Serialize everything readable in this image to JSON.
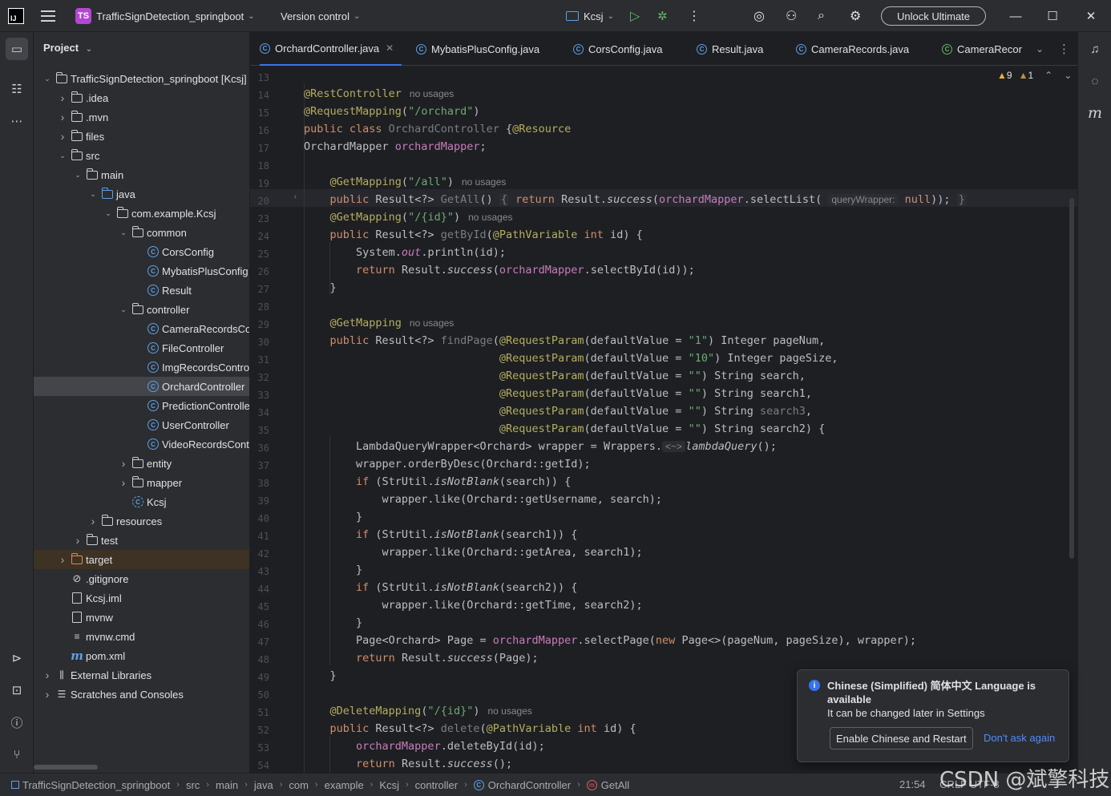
{
  "titlebar": {
    "project_badge": "TS",
    "project_name": "TrafficSignDetection_springboot",
    "vcs": "Version control",
    "run_config": "Kcsj",
    "unlock": "Unlock Ultimate"
  },
  "project_panel": {
    "title": "Project",
    "tree": [
      {
        "label": "TrafficSignDetection_springboot [Kcsj]",
        "depth": 0,
        "arrow": "v",
        "icon": "folder"
      },
      {
        "label": ".idea",
        "depth": 1,
        "arrow": ">",
        "icon": "folder"
      },
      {
        "label": ".mvn",
        "depth": 1,
        "arrow": ">",
        "icon": "folder"
      },
      {
        "label": "files",
        "depth": 1,
        "arrow": ">",
        "icon": "folder"
      },
      {
        "label": "src",
        "depth": 1,
        "arrow": "v",
        "icon": "folder"
      },
      {
        "label": "main",
        "depth": 2,
        "arrow": "v",
        "icon": "folder"
      },
      {
        "label": "java",
        "depth": 3,
        "arrow": "v",
        "icon": "folder-blue"
      },
      {
        "label": "com.example.Kcsj",
        "depth": 4,
        "arrow": "v",
        "icon": "package"
      },
      {
        "label": "common",
        "depth": 5,
        "arrow": "v",
        "icon": "package"
      },
      {
        "label": "CorsConfig",
        "depth": 6,
        "arrow": "",
        "icon": "class"
      },
      {
        "label": "MybatisPlusConfig",
        "depth": 6,
        "arrow": "",
        "icon": "class"
      },
      {
        "label": "Result",
        "depth": 6,
        "arrow": "",
        "icon": "class"
      },
      {
        "label": "controller",
        "depth": 5,
        "arrow": "v",
        "icon": "package"
      },
      {
        "label": "CameraRecordsController",
        "depth": 6,
        "arrow": "",
        "icon": "class"
      },
      {
        "label": "FileController",
        "depth": 6,
        "arrow": "",
        "icon": "class"
      },
      {
        "label": "ImgRecordsController",
        "depth": 6,
        "arrow": "",
        "icon": "class"
      },
      {
        "label": "OrchardController",
        "depth": 6,
        "arrow": "",
        "icon": "class",
        "selected": true
      },
      {
        "label": "PredictionController",
        "depth": 6,
        "arrow": "",
        "icon": "class"
      },
      {
        "label": "UserController",
        "depth": 6,
        "arrow": "",
        "icon": "class"
      },
      {
        "label": "VideoRecordsController",
        "depth": 6,
        "arrow": "",
        "icon": "class"
      },
      {
        "label": "entity",
        "depth": 5,
        "arrow": ">",
        "icon": "package"
      },
      {
        "label": "mapper",
        "depth": 5,
        "arrow": ">",
        "icon": "package"
      },
      {
        "label": "Kcsj",
        "depth": 5,
        "arrow": "",
        "icon": "class-run"
      },
      {
        "label": "resources",
        "depth": 3,
        "arrow": ">",
        "icon": "folder"
      },
      {
        "label": "test",
        "depth": 2,
        "arrow": ">",
        "icon": "folder"
      },
      {
        "label": "target",
        "depth": 1,
        "arrow": ">",
        "icon": "folder-orange",
        "excluded": true
      },
      {
        "label": ".gitignore",
        "depth": 1,
        "arrow": "",
        "icon": "ignore"
      },
      {
        "label": "Kcsj.iml",
        "depth": 1,
        "arrow": "",
        "icon": "file"
      },
      {
        "label": "mvnw",
        "depth": 1,
        "arrow": "",
        "icon": "file"
      },
      {
        "label": "mvnw.cmd",
        "depth": 1,
        "arrow": "",
        "icon": "lines"
      },
      {
        "label": "pom.xml",
        "depth": 1,
        "arrow": "",
        "icon": "maven"
      },
      {
        "label": "External Libraries",
        "depth": 0,
        "arrow": ">",
        "icon": "library"
      },
      {
        "label": "Scratches and Consoles",
        "depth": 0,
        "arrow": ">",
        "icon": "scratch"
      }
    ]
  },
  "tabs": [
    {
      "label": "OrchardController.java",
      "active": true
    },
    {
      "label": "MybatisPlusConfig.java"
    },
    {
      "label": "CorsConfig.java"
    },
    {
      "label": "Result.java"
    },
    {
      "label": "CameraRecords.java"
    },
    {
      "label": "CameraRecor"
    }
  ],
  "editor": {
    "warnings": "9",
    "weak_warnings": "1",
    "line_numbers": [
      "13",
      "14",
      "15",
      "16",
      "17",
      "18",
      "19",
      "20",
      "23",
      "24",
      "25",
      "26",
      "27",
      "28",
      "29",
      "30",
      "31",
      "32",
      "33",
      "34",
      "35",
      "36",
      "37",
      "38",
      "39",
      "40",
      "41",
      "42",
      "43",
      "44",
      "45",
      "46",
      "47",
      "48",
      "49",
      "50",
      "51",
      "52",
      "53",
      "54"
    ],
    "hints": {
      "no_usages": "no usages",
      "query_wrapper": "queryWrapper:"
    }
  },
  "notification": {
    "title": "Chinese (Simplified) 简体中文 Language is available",
    "body": "It can be changed later in Settings",
    "primary": "Enable Chinese and Restart",
    "secondary": "Don't ask again"
  },
  "statusbar": {
    "crumbs": [
      "TrafficSignDetection_springboot",
      "src",
      "main",
      "java",
      "com",
      "example",
      "Kcsj",
      "controller",
      "OrchardController",
      "GetAll"
    ],
    "position": "21:54",
    "encoding": "CRLF  UTF-8"
  },
  "watermark": "CSDN @斌擎科技"
}
